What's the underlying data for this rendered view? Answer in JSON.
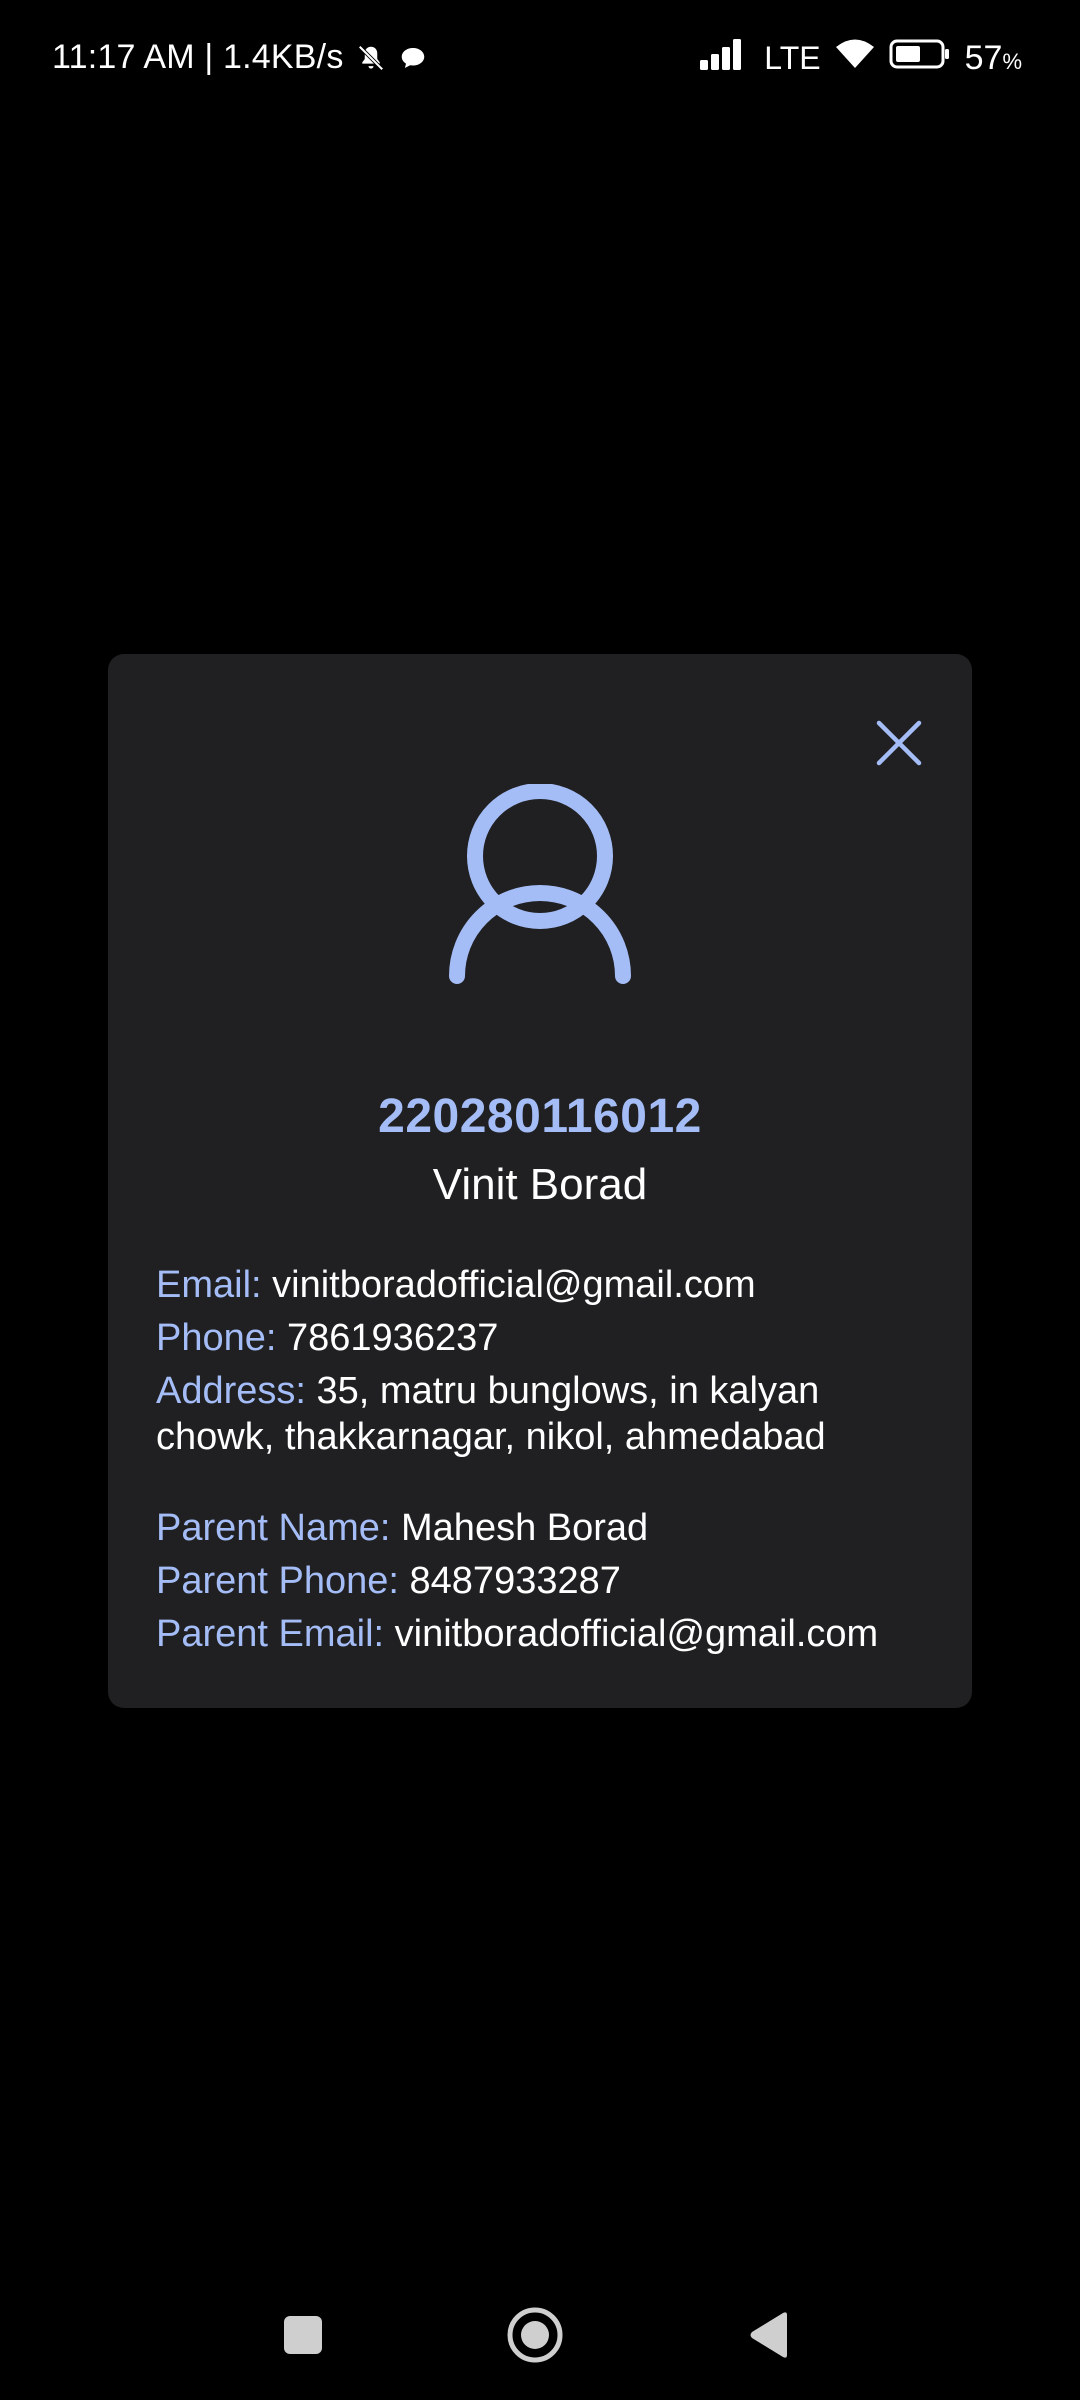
{
  "status_bar": {
    "time_and_speed": "11:17 AM | 1.4KB/s",
    "network": "LTE",
    "battery_value": "57",
    "battery_unit": "%",
    "battery_level": 0.57,
    "icons": [
      "muted-bell-icon",
      "chat-bubble-icon",
      "cell-signal-icon",
      "wifi-icon",
      "battery-icon"
    ]
  },
  "dialog": {
    "close_icon": "close-icon",
    "avatar_icon": "person-outline-icon",
    "student_id": "220280116012",
    "student_name": "Vinit Borad",
    "details": {
      "email_label": "Email:",
      "email_value": "vinitboradofficial@gmail.com",
      "phone_label": "Phone:",
      "phone_value": "7861936237",
      "address_label": "Address:",
      "address_value": "35, matru bunglows, in kalyan chowk, thakkarnagar, nikol, ahmedabad",
      "parent_name_label": "Parent Name:",
      "parent_name_value": "Mahesh Borad",
      "parent_phone_label": "Parent Phone:",
      "parent_phone_value": "8487933287",
      "parent_email_label": "Parent Email:",
      "parent_email_value": "vinitboradofficial@gmail.com"
    }
  },
  "nav_bar": {
    "icons": [
      "recents-square-icon",
      "home-circle-icon",
      "back-triangle-icon"
    ]
  },
  "colors": {
    "background": "#000000",
    "card": "#202022",
    "accent": "#a5bdf7",
    "text": "#ffffff",
    "nav_icon": "#cfcfcf"
  }
}
